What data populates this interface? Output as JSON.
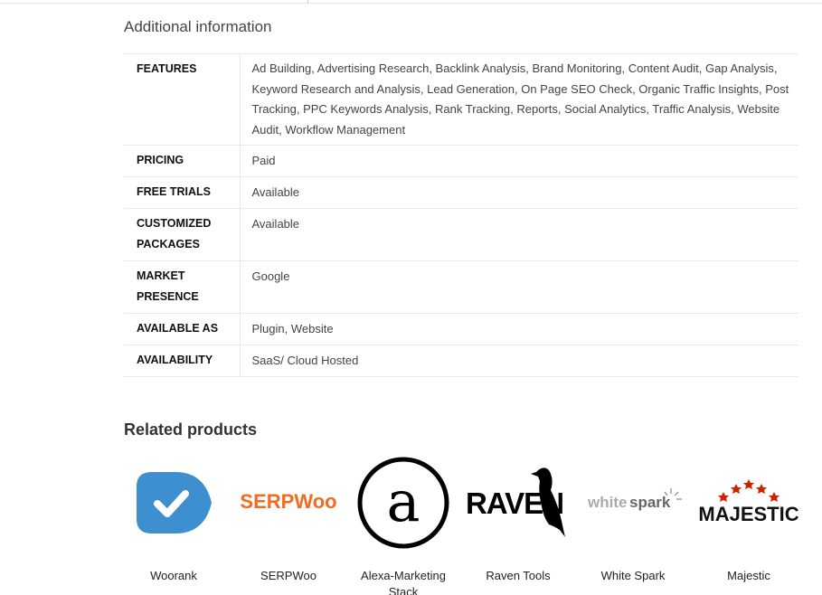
{
  "additional_info": {
    "title": "Additional information",
    "rows": [
      {
        "label": "FEATURES",
        "value": "Ad Building, Advertising Research, Backlink Analysis, Brand Monitoring, Content Audit, Gap Analysis, Keyword Research and Analysis, Lead Generation, On Page SEO Check, Organic Traffic Insights, Post Tracking, PPC Keywords Analysis, Rank Tracking, Reports, Social Analytics, Traffic Analysis, Website Audit, Workflow Management"
      },
      {
        "label": "PRICING",
        "value": "Paid"
      },
      {
        "label": "FREE TRIALS",
        "value": "Available"
      },
      {
        "label": "CUSTOMIZED PACKAGES",
        "value": "Available"
      },
      {
        "label": "MARKET PRESENCE",
        "value": "Google"
      },
      {
        "label": "AVAILABLE AS",
        "value": "Plugin, Website"
      },
      {
        "label": "AVAILABILITY",
        "value": "SaaS/ Cloud Hosted"
      }
    ]
  },
  "related": {
    "title": "Related products",
    "products": [
      {
        "name": "Woorank",
        "icon": "woorank-logo",
        "color": "#3d8fd0"
      },
      {
        "name": "SERPWoo",
        "icon": "serpwoo-logo",
        "logo_text": "SERPWoo",
        "color": "#f26b21"
      },
      {
        "name": "Alexa-Marketing Stack",
        "icon": "alexa-logo",
        "color": "#000000"
      },
      {
        "name": "Raven Tools",
        "icon": "raven-logo",
        "logo_text": "RAVEN",
        "color": "#000000"
      },
      {
        "name": "White Spark",
        "icon": "whitespark-logo",
        "logo_text_a": "white",
        "logo_text_b": "spark",
        "color": "#999999"
      },
      {
        "name": "Majestic",
        "icon": "majestic-logo",
        "logo_text": "MAJESTIC",
        "color": "#cc2200"
      }
    ]
  }
}
